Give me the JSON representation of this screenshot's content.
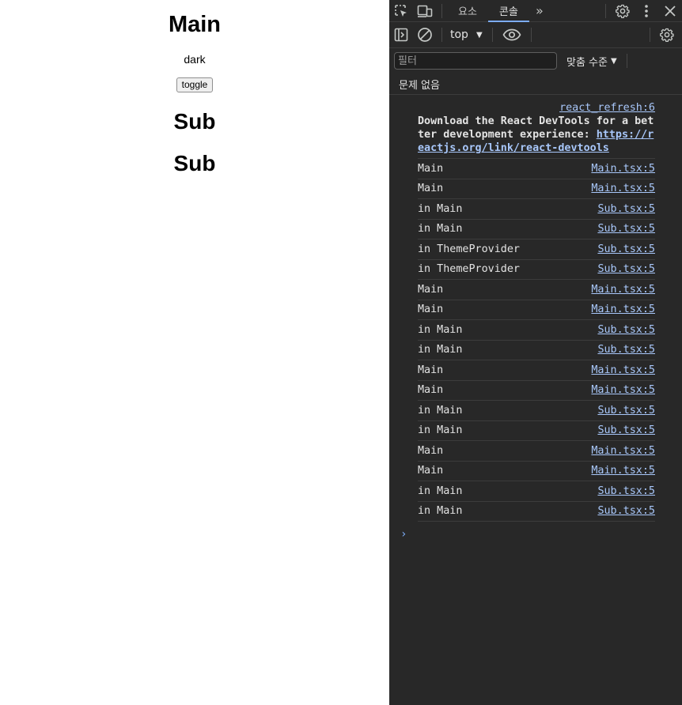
{
  "app": {
    "title": "Main",
    "theme_label": "dark",
    "toggle_label": "toggle",
    "subs": [
      "Sub",
      "Sub"
    ]
  },
  "devtools": {
    "tabs": [
      {
        "label": "요소",
        "active": false
      },
      {
        "label": "콘솔",
        "active": true
      }
    ],
    "more_tabs_glyph": "»",
    "context": "top",
    "filter_placeholder": "필터",
    "levels_label": "맞춤 수준",
    "issues_label": "문제 없음",
    "intro": {
      "source": "react_refresh:6",
      "text": "Download the React DevTools for a better development experience: ",
      "link": "https://reactjs.org/link/react-devtools"
    },
    "logs": [
      {
        "msg": "Main",
        "src": "Main.tsx:5"
      },
      {
        "msg": "Main",
        "src": "Main.tsx:5"
      },
      {
        "msg": "in Main",
        "src": "Sub.tsx:5"
      },
      {
        "msg": "in Main",
        "src": "Sub.tsx:5"
      },
      {
        "msg": "in ThemeProvider",
        "src": "Sub.tsx:5"
      },
      {
        "msg": "in ThemeProvider",
        "src": "Sub.tsx:5"
      },
      {
        "msg": "Main",
        "src": "Main.tsx:5"
      },
      {
        "msg": "Main",
        "src": "Main.tsx:5"
      },
      {
        "msg": "in Main",
        "src": "Sub.tsx:5"
      },
      {
        "msg": "in Main",
        "src": "Sub.tsx:5"
      },
      {
        "msg": "Main",
        "src": "Main.tsx:5"
      },
      {
        "msg": "Main",
        "src": "Main.tsx:5"
      },
      {
        "msg": "in Main",
        "src": "Sub.tsx:5"
      },
      {
        "msg": "in Main",
        "src": "Sub.tsx:5"
      },
      {
        "msg": "Main",
        "src": "Main.tsx:5"
      },
      {
        "msg": "Main",
        "src": "Main.tsx:5"
      },
      {
        "msg": "in Main",
        "src": "Sub.tsx:5"
      },
      {
        "msg": "in Main",
        "src": "Sub.tsx:5"
      }
    ],
    "prompt_glyph": "›",
    "colors": {
      "panel_bg": "#282828",
      "link": "#a8c7fa",
      "accent": "#7cacf8",
      "text": "#e3e3e3"
    }
  }
}
